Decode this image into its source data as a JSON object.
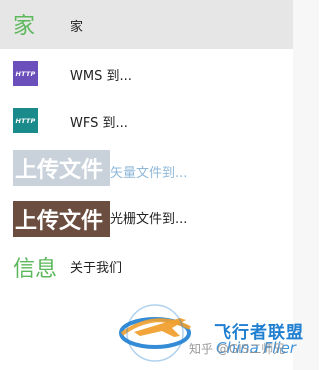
{
  "menu": {
    "items": [
      {
        "icon_text": "家",
        "icon_color": "#5cb85c",
        "label": "家",
        "selected": true
      },
      {
        "badge_text": "HTTP",
        "badge_color": "#6b4fbb",
        "label": "WMS 到..."
      },
      {
        "badge_text": "HTTP",
        "badge_color": "#1b8a8a",
        "label": "WFS 到..."
      },
      {
        "badge_text": "上传文件",
        "label": "矢量文件到...",
        "label_color": "#8fb8d8"
      },
      {
        "badge_text": "上传文件",
        "label": "光栅文件到..."
      },
      {
        "icon_text": "信息",
        "icon_color": "#5cb85c",
        "label": "关于我们"
      }
    ]
  },
  "watermark": {
    "brand_cn": "飞行者联盟",
    "brand_en": "China Flier",
    "source": "知乎 @GIS二师兄"
  }
}
